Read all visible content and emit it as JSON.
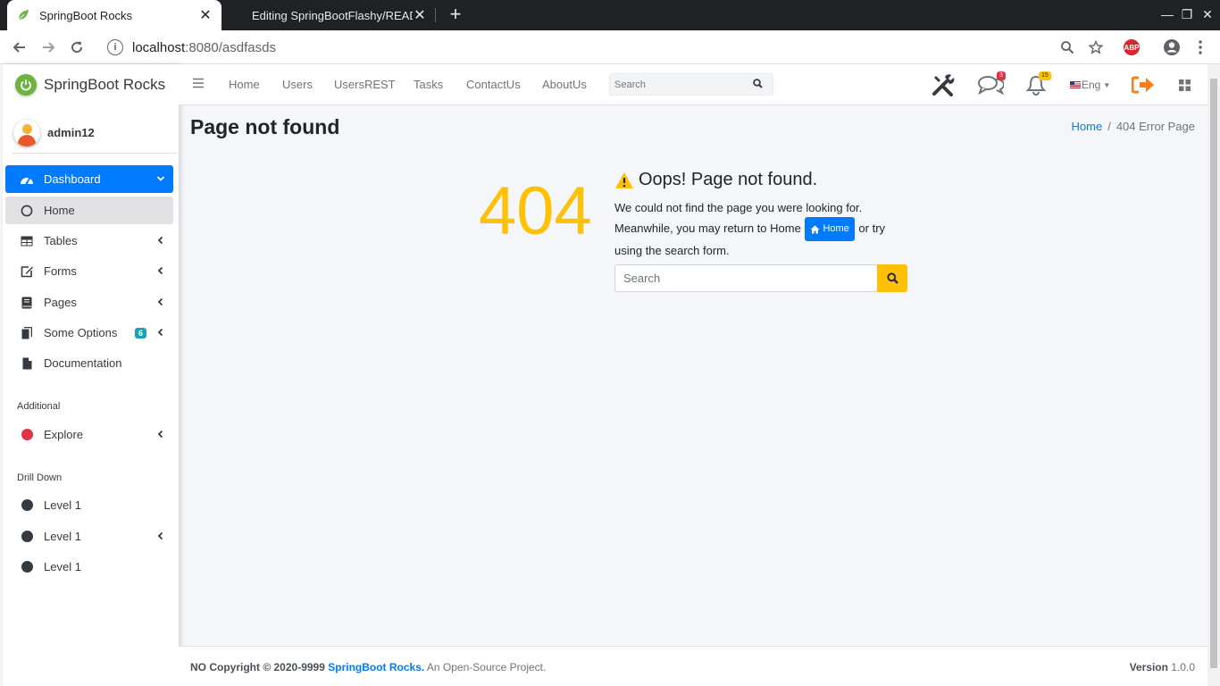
{
  "browser": {
    "tabs": [
      {
        "title": "SpringBoot Rocks",
        "active": true
      },
      {
        "title": "Editing SpringBootFlashy/READ",
        "active": false
      }
    ],
    "url_host": "localhost",
    "url_path": ":8080/asdfasds",
    "abp_label": "ABP"
  },
  "sidebar": {
    "brand": "SpringBoot Rocks",
    "user": "admin12",
    "items": [
      {
        "label": "Dashboard",
        "icon": "tachometer-icon"
      },
      {
        "label": "Home",
        "icon": "circle-outline-icon"
      },
      {
        "label": "Tables",
        "icon": "table-icon"
      },
      {
        "label": "Forms",
        "icon": "edit-icon"
      },
      {
        "label": "Pages",
        "icon": "book-icon"
      },
      {
        "label": "Some Options",
        "icon": "copy-icon",
        "badge": "6"
      },
      {
        "label": "Documentation",
        "icon": "file-icon"
      }
    ],
    "header_additional": "Additional",
    "explore": {
      "label": "Explore",
      "color": "#dc3545"
    },
    "header_drilldown": "Drill Down",
    "levels": [
      {
        "label": "Level 1"
      },
      {
        "label": "Level 1"
      },
      {
        "label": "Level 1"
      }
    ]
  },
  "header": {
    "nav": [
      "Home",
      "Users",
      "UsersREST",
      "Tasks",
      "ContactUs",
      "AboutUs"
    ],
    "search_placeholder": "Search",
    "messages_count": "3",
    "notifications_count": "15",
    "language": "Eng"
  },
  "content": {
    "title": "Page not found",
    "breadcrumb_home": "Home",
    "breadcrumb_current": "404 Error Page",
    "error_code": "404",
    "error_title": "Oops! Page not found.",
    "error_line1": "We could not find the page you were looking for.",
    "error_line2_pre": "Meanwhile, you may return to Home",
    "home_button": "Home",
    "error_line2_post": "or try",
    "error_line3": "using the search form.",
    "search_placeholder": "Search"
  },
  "footer": {
    "copyright": "NO Copyright © 2020-9999",
    "brand_link": "SpringBoot Rocks.",
    "tagline": "An Open-Source Project.",
    "version_label": "Version",
    "version": "1.0.0"
  },
  "colors": {
    "primary": "#007bff",
    "warning": "#ffc107",
    "danger": "#dc3545",
    "info": "#17a2b8",
    "dark": "#343a40"
  }
}
